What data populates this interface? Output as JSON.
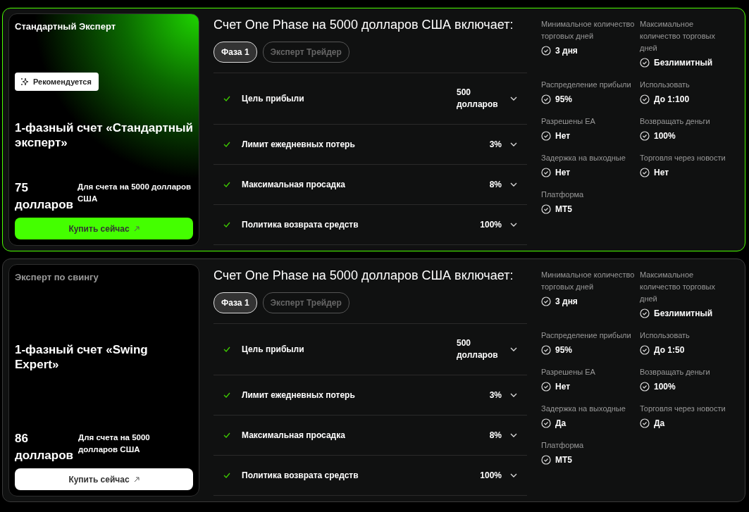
{
  "plans": [
    {
      "featured": true,
      "category": "Стандартный Эксперт",
      "badge": "Рекомендуется",
      "name": "1-фазный счет «Стандартный эксперт»",
      "price": "75 долларов",
      "price_note": "Для счета на 5000 долларов США",
      "buy_label": "Купить сейчас",
      "includes_title": "Счет One Phase на 5000 долларов США включает:",
      "tabs": [
        {
          "label": "Фаза 1",
          "selected": true
        },
        {
          "label": "Эксперт Трейдер",
          "selected": false
        }
      ],
      "rules": [
        {
          "label": "Цель прибыли",
          "value": "500 долларов"
        },
        {
          "label": "Лимит ежедневных потерь",
          "value": "3%"
        },
        {
          "label": "Максимальная просадка",
          "value": "8%"
        },
        {
          "label": "Политика возврата средств",
          "value": "100%"
        }
      ],
      "stats": [
        {
          "label": "Минимальное количество торговых дней",
          "value": "3 дня"
        },
        {
          "label": "Максимальное количество торговых дней",
          "value": "Безлимитный"
        },
        {
          "label": "Распределение прибыли",
          "value": "95%"
        },
        {
          "label": "Использовать",
          "value": "До 1:100"
        },
        {
          "label": "Разрешены EA",
          "value": "Нет"
        },
        {
          "label": "Возвращать деньги",
          "value": "100%"
        },
        {
          "label": "Задержка на выходные",
          "value": "Нет"
        },
        {
          "label": "Торговля через новости",
          "value": "Нет"
        },
        {
          "label": "Платформа",
          "value": "MT5"
        }
      ]
    },
    {
      "featured": false,
      "category": "Эксперт по свингу",
      "name": "1-фазный счет «Swing Expert»",
      "price": "86 долларов",
      "price_note": "Для счета на 5000 долларов США",
      "buy_label": "Купить сейчас",
      "includes_title": "Счет One Phase на 5000 долларов США включает:",
      "tabs": [
        {
          "label": "Фаза 1",
          "selected": true
        },
        {
          "label": "Эксперт Трейдер",
          "selected": false
        }
      ],
      "rules": [
        {
          "label": "Цель прибыли",
          "value": "500 долларов"
        },
        {
          "label": "Лимит ежедневных потерь",
          "value": "3%"
        },
        {
          "label": "Максимальная просадка",
          "value": "8%"
        },
        {
          "label": "Политика возврата средств",
          "value": "100%"
        }
      ],
      "stats": [
        {
          "label": "Минимальное количество торговых дней",
          "value": "3 дня"
        },
        {
          "label": "Максимальное количество торговых дней",
          "value": "Безлимитный"
        },
        {
          "label": "Распределение прибыли",
          "value": "95%"
        },
        {
          "label": "Использовать",
          "value": "До 1:50"
        },
        {
          "label": "Разрешены EA",
          "value": "Нет"
        },
        {
          "label": "Возвращать деньги",
          "value": "100%"
        },
        {
          "label": "Задержка на выходные",
          "value": "Да"
        },
        {
          "label": "Торговля через новости",
          "value": "Да"
        },
        {
          "label": "Платформа",
          "value": "MT5"
        }
      ]
    }
  ]
}
